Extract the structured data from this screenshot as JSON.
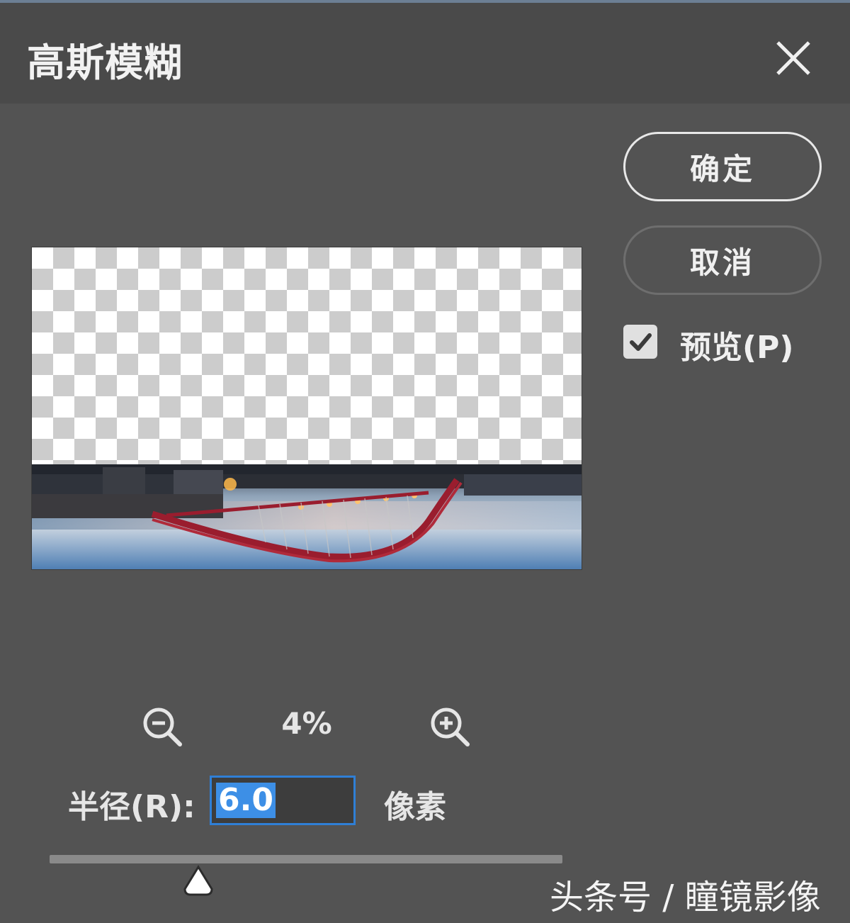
{
  "dialog": {
    "title": "高斯模糊",
    "close_icon": "close-icon"
  },
  "buttons": {
    "ok_label": "确定",
    "cancel_label": "取消"
  },
  "preview_option": {
    "label": "预览(P)",
    "checked": true
  },
  "zoom": {
    "level": "4%",
    "zoom_out_icon": "zoom-out-icon",
    "zoom_in_icon": "zoom-in-icon"
  },
  "radius": {
    "label": "半径(R):",
    "value": "6.0",
    "unit": "像素",
    "slider_fraction": 0.29
  },
  "watermark": "头条号 / 瞳镜影像",
  "colors": {
    "dialog_bg": "#535353",
    "titlebar_bg": "#4a4a4a",
    "focus_blue": "#2f7fd6",
    "selection_blue": "#3d8fe6"
  }
}
